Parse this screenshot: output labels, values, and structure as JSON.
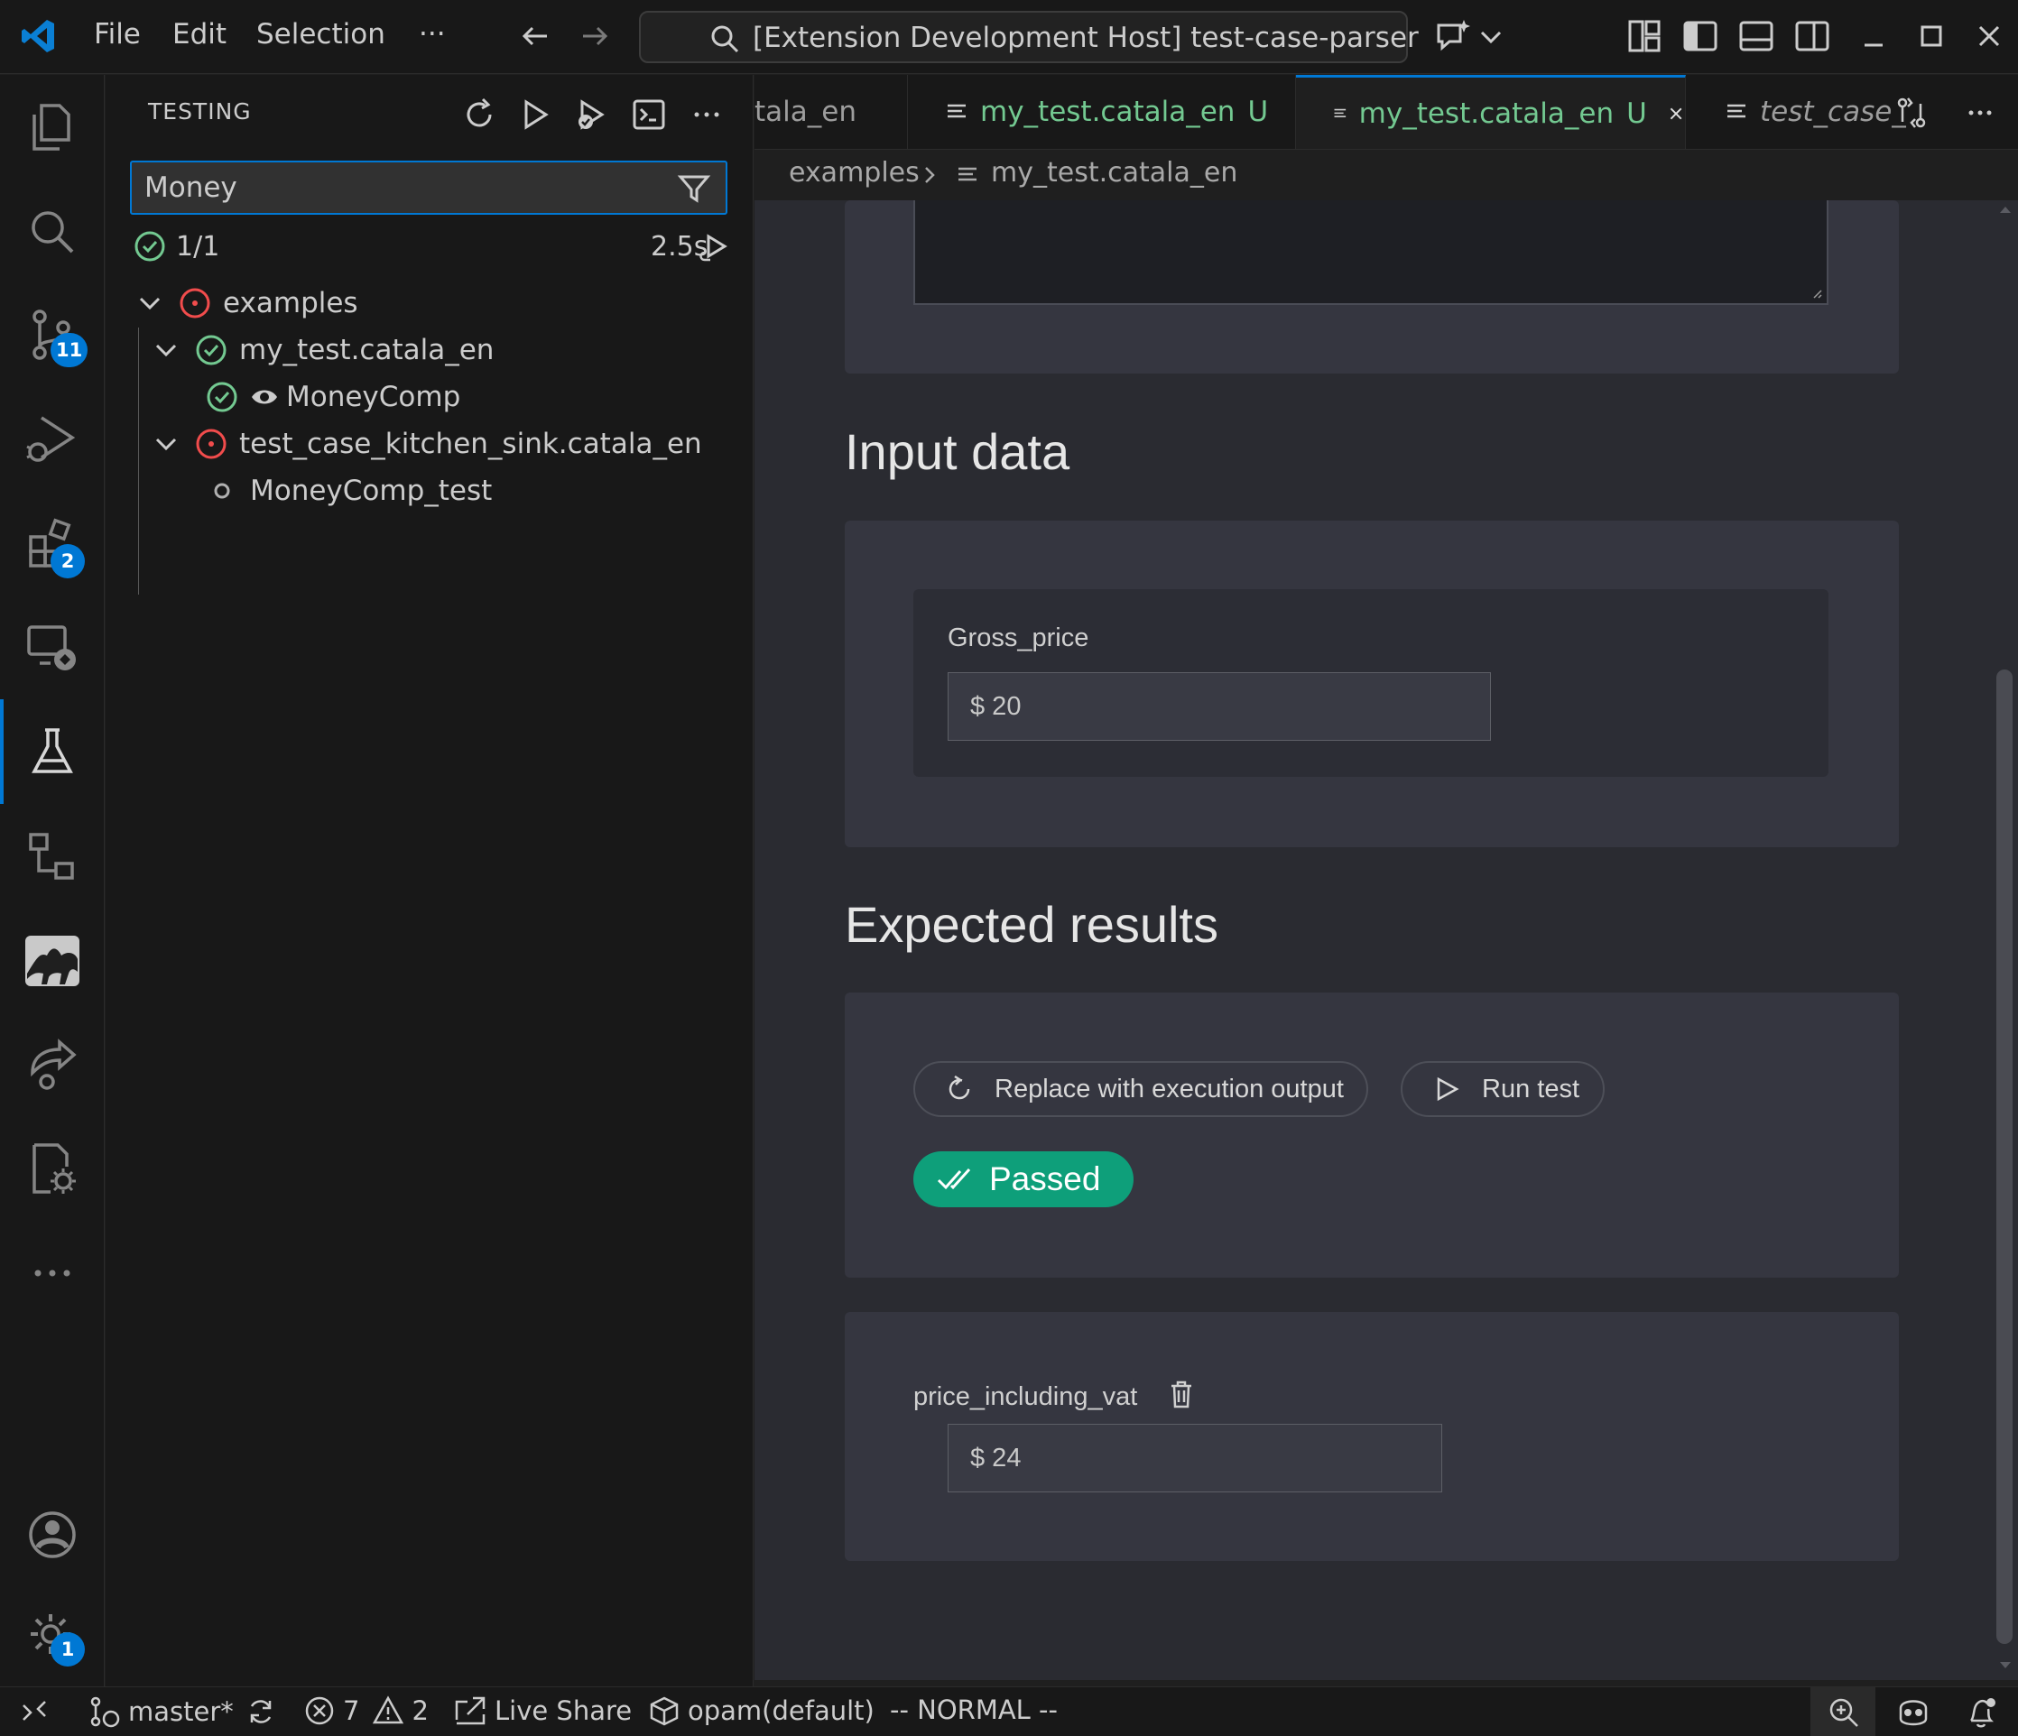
{
  "titlebar": {
    "menu": [
      "File",
      "Edit",
      "Selection",
      "···"
    ],
    "command_center": "[Extension Development Host] test-case-parser"
  },
  "activity_bar": {
    "source_control_badge": "11",
    "extensions_badge": "2",
    "settings_badge": "1"
  },
  "sidebar": {
    "title": "TESTING",
    "filter_value": "Money",
    "summary_count": "1/1",
    "summary_duration": "2.5s",
    "tree": [
      {
        "label": "examples",
        "status": "error"
      },
      {
        "label": "my_test.catala_en",
        "status": "passed"
      },
      {
        "label": "MoneyComp",
        "status": "passed"
      },
      {
        "label": "test_case_kitchen_sink.catala_en",
        "status": "error"
      },
      {
        "label": "MoneyComp_test",
        "status": "unset"
      }
    ]
  },
  "tabs": [
    {
      "label": "tala_en"
    },
    {
      "label": "my_test.catala_en",
      "marker": "U"
    },
    {
      "label": "my_test.catala_en",
      "marker": "U"
    },
    {
      "label": "test_case_"
    }
  ],
  "breadcrumb": {
    "folder": "examples",
    "file": "my_test.catala_en"
  },
  "form": {
    "input_heading": "Input data",
    "gross_price_label": "Gross_price",
    "gross_price_value": "$ 20",
    "expected_heading": "Expected results",
    "replace_button": "Replace with execution output",
    "run_button": "Run test",
    "status": "Passed",
    "output_label": "price_including_vat",
    "output_value": "$ 24"
  },
  "statusbar": {
    "branch": "master*",
    "errors": "7",
    "warnings": "2",
    "live_share": "Live Share",
    "opam": "opam(default)",
    "mode": "-- NORMAL --"
  },
  "colors": {
    "accent": "#0078d4",
    "passed": "#0e9f7a",
    "untracked": "#73c991",
    "error": "#f14c4c",
    "check": "#73c991"
  }
}
